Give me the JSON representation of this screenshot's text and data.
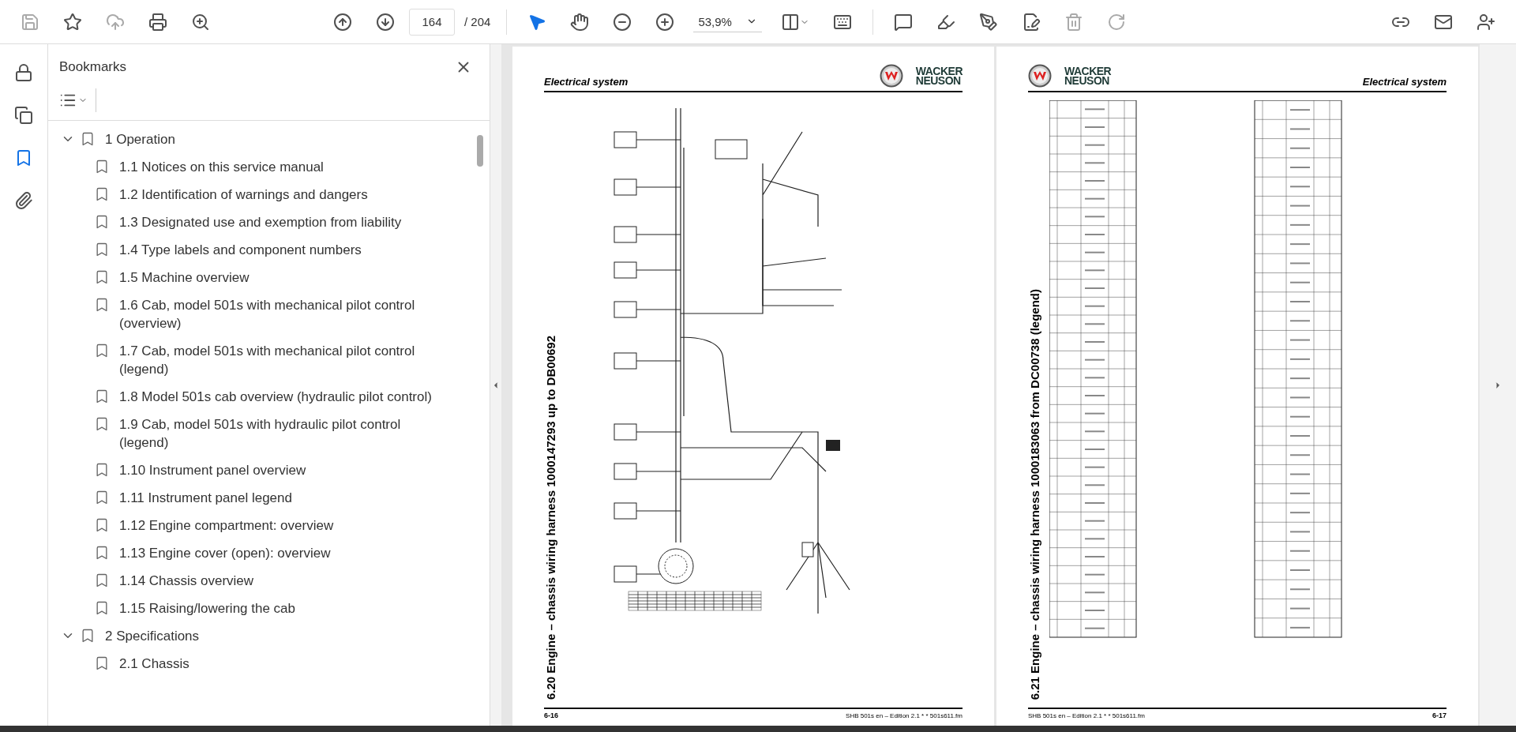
{
  "toolbar": {
    "page_input": "164",
    "page_count": "/ 204",
    "zoom": "53,9%"
  },
  "side_rail": [
    {
      "kind": "lock",
      "selected": false
    },
    {
      "kind": "pages",
      "selected": false
    },
    {
      "kind": "bookmarks",
      "selected": true
    },
    {
      "kind": "attachments",
      "selected": false
    }
  ],
  "bookmarks_panel": {
    "title": "Bookmarks",
    "items": [
      {
        "label": "1 Operation",
        "expanded": true,
        "children": [
          {
            "label": "1.1 Notices on this service manual"
          },
          {
            "label": "1.2 Identification of warnings and dangers"
          },
          {
            "label": "1.3 Designated use and exemption from liability"
          },
          {
            "label": "1.4 Type labels and component numbers"
          },
          {
            "label": "1.5 Machine overview"
          },
          {
            "label": "1.6 Cab, model 501s with mechanical pilot control (overview)"
          },
          {
            "label": "1.7 Cab, model 501s with mechanical pilot control (legend)"
          },
          {
            "label": "1.8 Model 501s cab overview (hydraulic pilot control)"
          },
          {
            "label": "1.9 Cab, model 501s with hydraulic pilot control (legend)"
          },
          {
            "label": "1.10 Instrument panel overview"
          },
          {
            "label": "1.11 Instrument panel legend"
          },
          {
            "label": "1.12 Engine compartment: overview"
          },
          {
            "label": "1.13 Engine cover (open): overview"
          },
          {
            "label": "1.14 Chassis overview"
          },
          {
            "label": "1.15 Raising/lowering the cab"
          }
        ]
      },
      {
        "label": "2 Specifications",
        "expanded": true,
        "children": [
          {
            "label": "2.1 Chassis"
          }
        ]
      }
    ]
  },
  "pages": [
    {
      "kind": "diagram",
      "header": "Electrical system",
      "logo": [
        "WACKER",
        "NEUSON"
      ],
      "section_title": "6.20 Engine – chassis wiring harness 1000147293 up to DB00692",
      "page_number": "6-16",
      "footer_note": "SHB 501s en – Edition 2.1 * * 501s611.fm"
    },
    {
      "kind": "legend",
      "header": "Electrical system",
      "logo": [
        "WACKER",
        "NEUSON"
      ],
      "section_title": "6.21 Engine – chassis wiring harness 1000183063 from DC00738 (legend)",
      "page_number": "6-17",
      "footer_note": "SHB 501s en – Edition 2.1 * * 501s611.fm"
    }
  ]
}
